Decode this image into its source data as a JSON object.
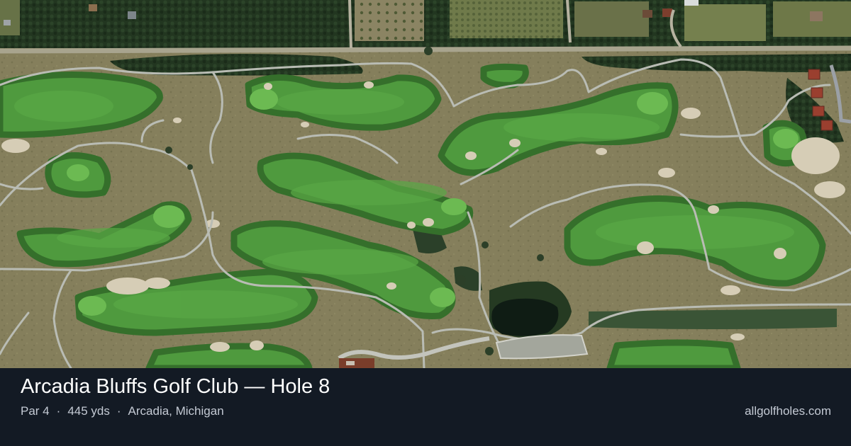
{
  "title": "Arcadia Bluffs Golf Club — Hole 8",
  "meta": {
    "par": "Par 4",
    "yardage": "445 yds",
    "location": "Arcadia, Michigan",
    "separator": "·"
  },
  "site": "allgolfholes.com",
  "colors": {
    "footer_background": "#131a24",
    "title_text": "#ffffff",
    "meta_text": "#c4cad4",
    "rough": "#857f5c",
    "fairway": "#4f9a3e",
    "fairway_edge": "#356f2b",
    "cart_path": "#b9bcb4",
    "trees": "#243822",
    "sand": "#d6cdb6",
    "pond": "#0f1c14"
  },
  "map_layers": [
    "rough",
    "trees",
    "fairways",
    "greens",
    "bunkers",
    "cart-paths",
    "pond",
    "clubhouse",
    "cottages",
    "road"
  ]
}
